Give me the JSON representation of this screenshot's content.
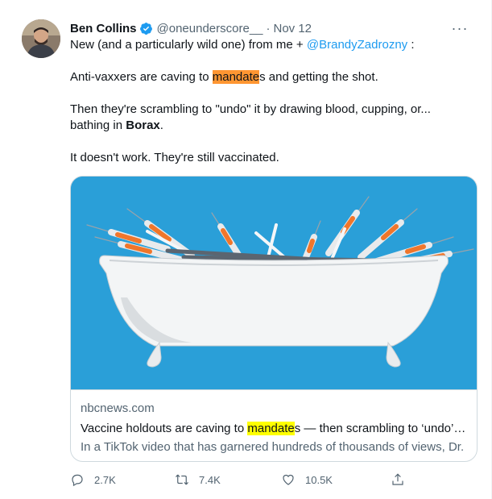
{
  "author": {
    "name": "Ben Collins",
    "handle": "@oneunderscore__",
    "separator": "·",
    "date": "Nov 12"
  },
  "more_label": "···",
  "tweet": {
    "line1_pre": "New (and a particularly wild one) from me + ",
    "line1_mention": "@BrandyZadrozny",
    "line1_post": " :",
    "line2_pre": "Anti-vaxxers are caving to ",
    "line2_highlight": "mandate",
    "line2_post": "s and getting the shot.",
    "line3_pre": "Then they're scrambling to \"undo\" it by drawing blood, cupping, or...",
    "line3b_pre": "bathing in ",
    "line3b_bold": "Borax",
    "line3b_post": ".",
    "line4": "It doesn't work. They're still vaccinated."
  },
  "card": {
    "domain": "nbcnews.com",
    "title_pre": "Vaccine holdouts are caving to ",
    "title_highlight": "mandate",
    "title_post": "s — then scrambling to ‘undo’…",
    "description": "In a TikTok video that has garnered hundreds of thousands of views, Dr."
  },
  "actions": {
    "reply_count": "2.7K",
    "retweet_count": "7.4K",
    "like_count": "10.5K"
  },
  "colors": {
    "accent": "#1d9bf0",
    "highlight_orange": "#ff9632",
    "highlight_yellow": "#ffff00",
    "image_bg": "#2a9fd8"
  }
}
